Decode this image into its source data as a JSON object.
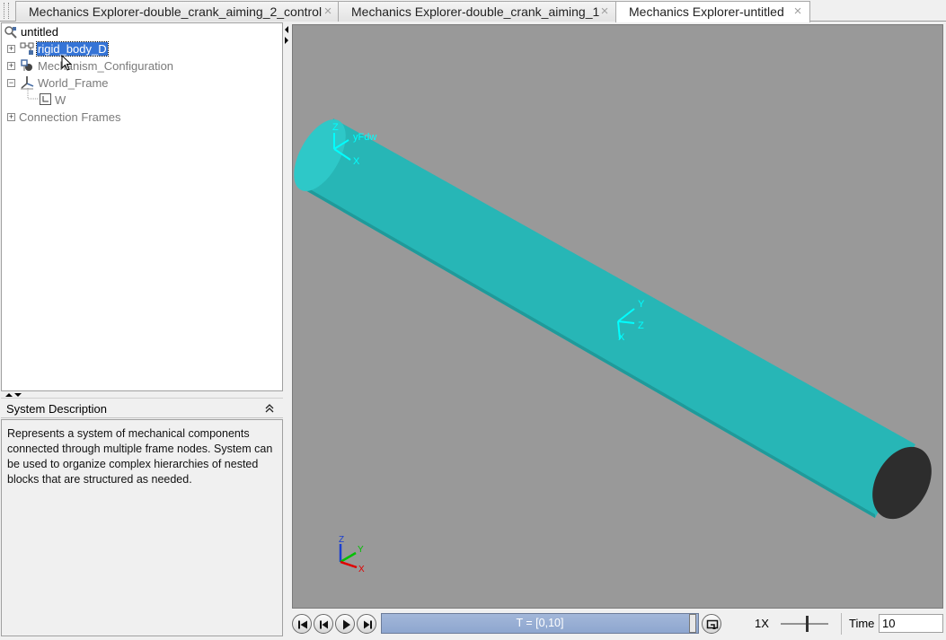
{
  "tabs": [
    {
      "label": "Mechanics Explorer-double_crank_aiming_2_control",
      "active": false
    },
    {
      "label": "Mechanics Explorer-double_crank_aiming_1",
      "active": false
    },
    {
      "label": "Mechanics Explorer-untitled",
      "active": true
    }
  ],
  "tab_close_glyph": "×",
  "tree": {
    "root": "untitled",
    "nodes": [
      {
        "label": "rigid_body_D",
        "selected": true,
        "icon": "rigid-body-icon"
      },
      {
        "label": "Mechanism_Configuration",
        "icon": "mechanism-config-icon"
      },
      {
        "label": "World_Frame",
        "icon": "world-frame-icon"
      },
      {
        "label": "W",
        "icon": "frame-icon"
      },
      {
        "label": "Connection Frames"
      }
    ]
  },
  "description": {
    "title": "System Description",
    "text": "Represents a system of mechanical components connected through multiple frame nodes. System can be used to organize complex hierarchies of nested blocks that are structured as needed."
  },
  "viewer": {
    "background": "#999999",
    "body_color": "#2ec8c8",
    "triad_color": "#00ffff",
    "frame_labels": {
      "f1_z": "Z",
      "f1_y": "yFdw",
      "f1_x": "X",
      "f2_y": "Y",
      "f2_z": "Z",
      "f2_x": "X"
    },
    "axis_triad": {
      "z": "Z",
      "y": "Y",
      "x": "X"
    }
  },
  "playback": {
    "time_range": "T = [0,10]",
    "speed": "1X",
    "time_label": "Time",
    "time_value": "10"
  }
}
